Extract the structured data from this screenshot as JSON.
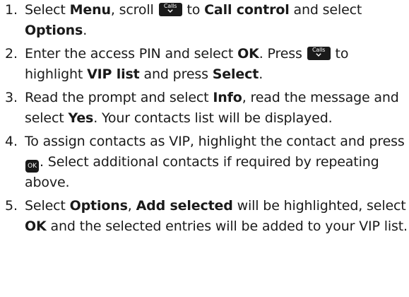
{
  "instructions": {
    "steps": [
      {
        "number": "1.",
        "runs": [
          {
            "text": "Select "
          },
          {
            "text": "Menu",
            "bold": true
          },
          {
            "text": ", scroll "
          },
          {
            "key": "calls",
            "label": "Calls"
          },
          {
            "text": " to "
          },
          {
            "text": "Call control",
            "bold": true
          },
          {
            "text": " and select "
          },
          {
            "text": "Options",
            "bold": true
          },
          {
            "text": "."
          }
        ]
      },
      {
        "number": "2.",
        "runs": [
          {
            "text": "Enter the access PIN and select "
          },
          {
            "text": "OK",
            "bold": true
          },
          {
            "text": ". Press "
          },
          {
            "key": "calls",
            "label": "Calls"
          },
          {
            "text": " to highlight "
          },
          {
            "text": "VIP list",
            "bold": true
          },
          {
            "text": " and press "
          },
          {
            "text": "Select",
            "bold": true
          },
          {
            "text": "."
          }
        ]
      },
      {
        "number": "3.",
        "runs": [
          {
            "text": "Read the prompt and select "
          },
          {
            "text": "Info",
            "bold": true
          },
          {
            "text": ", read the message and select "
          },
          {
            "text": "Yes",
            "bold": true
          },
          {
            "text": ". Your contacts list will be displayed."
          }
        ]
      },
      {
        "number": "4.",
        "runs": [
          {
            "text": "To assign contacts as VIP, highlight the contact and press "
          },
          {
            "key": "ok",
            "label": "OK"
          },
          {
            "text": ". Select additional contacts if required by repeating above."
          }
        ]
      },
      {
        "number": "5.",
        "runs": [
          {
            "text": "Select "
          },
          {
            "text": "Options",
            "bold": true
          },
          {
            "text": ", "
          },
          {
            "text": "Add selected",
            "bold": true
          },
          {
            "text": " will be highlighted, select "
          },
          {
            "text": "OK",
            "bold": true
          },
          {
            "text": " and the selected entries will be added to your VIP list."
          }
        ]
      }
    ]
  }
}
